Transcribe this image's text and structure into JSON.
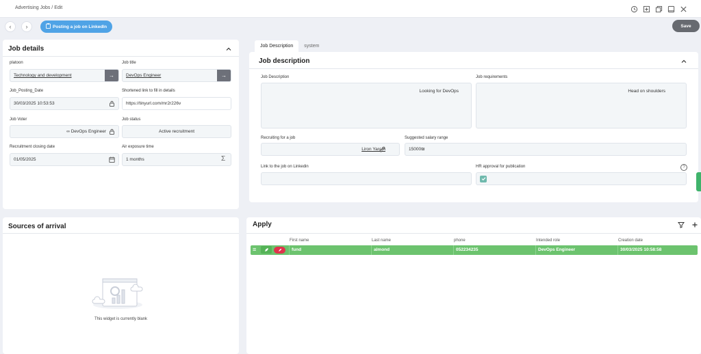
{
  "header": {
    "breadcrumb": "Advertising Jobs / Edit",
    "icons": [
      "history-icon",
      "add-square-icon",
      "copy-icon",
      "window-icon",
      "close-icon"
    ]
  },
  "toolbar": {
    "action_label": "Posting a job on LinkedIn",
    "save_label": "Save"
  },
  "job_details": {
    "title": "Job details",
    "fields": {
      "platoon": {
        "label": "platoon",
        "value": "Technology and development"
      },
      "job_title": {
        "label": "Job title",
        "value": "DevOps Engineer"
      },
      "posting_date": {
        "label": "Job_Posting_Date",
        "value": "30/03/2025 10:53:53"
      },
      "short_link": {
        "label": "Shortened link to fill in details",
        "value": "https://tinyurl.com/mr2r226v"
      },
      "voter": {
        "label": "Job Voter",
        "value": "∞ DevOps Engineer"
      },
      "status": {
        "label": "Job status",
        "value": "Active recruitment"
      },
      "closing_date": {
        "label": "Recruitment closing date",
        "value": "01/05/2025"
      },
      "exposure": {
        "label": "Air exposure time",
        "value": "1 months"
      }
    }
  },
  "tabs": [
    {
      "label": "Job Description",
      "active": true
    },
    {
      "label": "system",
      "active": false
    }
  ],
  "job_description": {
    "title": "Job description",
    "description": {
      "label": "Job Description",
      "value": "Looking for DevOps"
    },
    "requirements": {
      "label": "Job requirements",
      "value": "Head on shoulders"
    },
    "recruiting_for": {
      "label": "Recruiting for a job",
      "value": "Liron Yarom"
    },
    "salary": {
      "label": "Suggested salary range",
      "value": "15000₪"
    },
    "linkedin_link": {
      "label": "Link to the job on Linkedin",
      "value": ""
    },
    "hr_approval": {
      "label": "HR approval for publication",
      "checked": true
    }
  },
  "sources": {
    "title": "Sources of arrival",
    "empty_text": "This widget is currently blank"
  },
  "apply": {
    "title": "Apply",
    "columns": [
      "First name",
      "Last name",
      "phone",
      "Intended role",
      "Creation date"
    ],
    "rows": [
      {
        "first": "fund",
        "last": "almond",
        "phone": "052234235",
        "role": "DevOps Engineer",
        "created": "30/03/2025 10:58:58"
      }
    ],
    "row_color": "#6cc36e"
  },
  "colors": {
    "accent": "#4fa3e6",
    "save": "#676a70",
    "row": "#6cc36e",
    "badge": "#e0334c"
  }
}
